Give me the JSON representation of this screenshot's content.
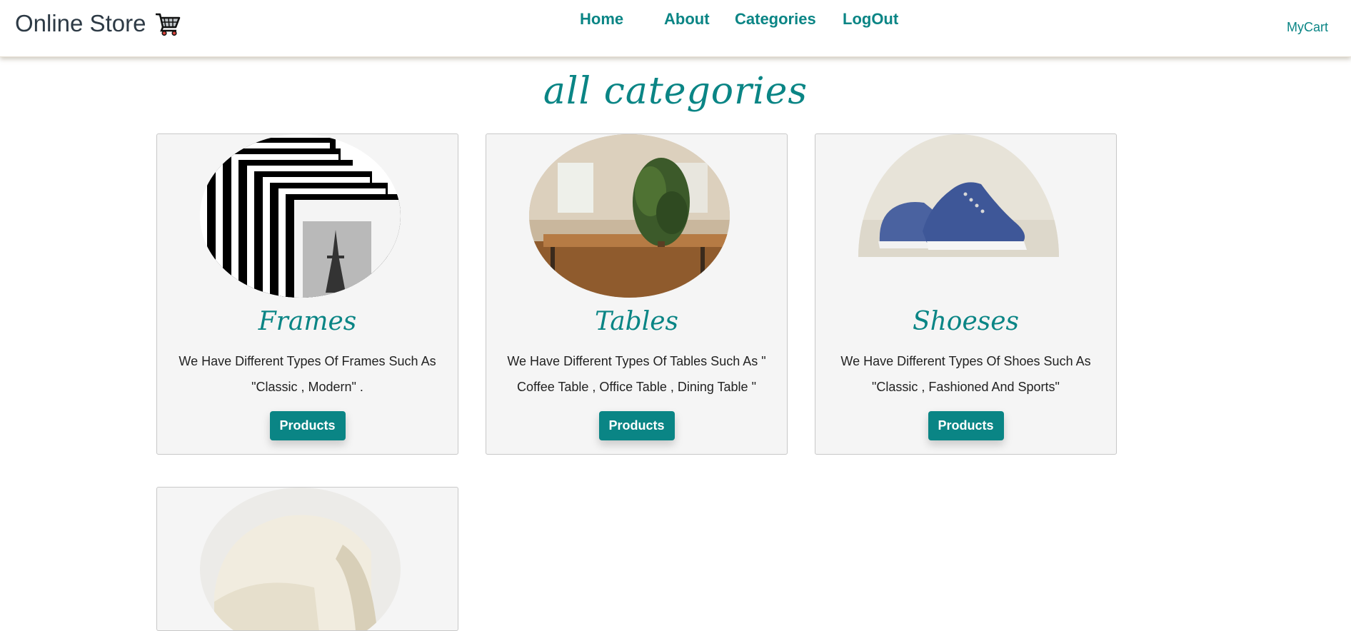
{
  "header": {
    "brand": "Online Store",
    "nav": [
      "Home",
      "About",
      "Categories",
      "LogOut"
    ],
    "mycart": "MyCart"
  },
  "page": {
    "title": "all categories"
  },
  "categories": [
    {
      "title": "Frames",
      "desc_line1": "We Have Different Types Of Frames Such As",
      "desc_line2": "\"Classic , Modern\" .",
      "button": "Products"
    },
    {
      "title": "Tables",
      "desc_line1": "We Have Different Types Of Tables Such As \"",
      "desc_line2": "Coffee Table , Office Table , Dining Table \"",
      "button": "Products"
    },
    {
      "title": "Shoeses",
      "desc_line1": "We Have Different Types Of Shoes Such As",
      "desc_line2": "\"Classic , Fashioned And Sports\"",
      "button": "Products"
    }
  ],
  "colors": {
    "accent": "#0a8585",
    "card_bg": "#f5f5f5"
  }
}
